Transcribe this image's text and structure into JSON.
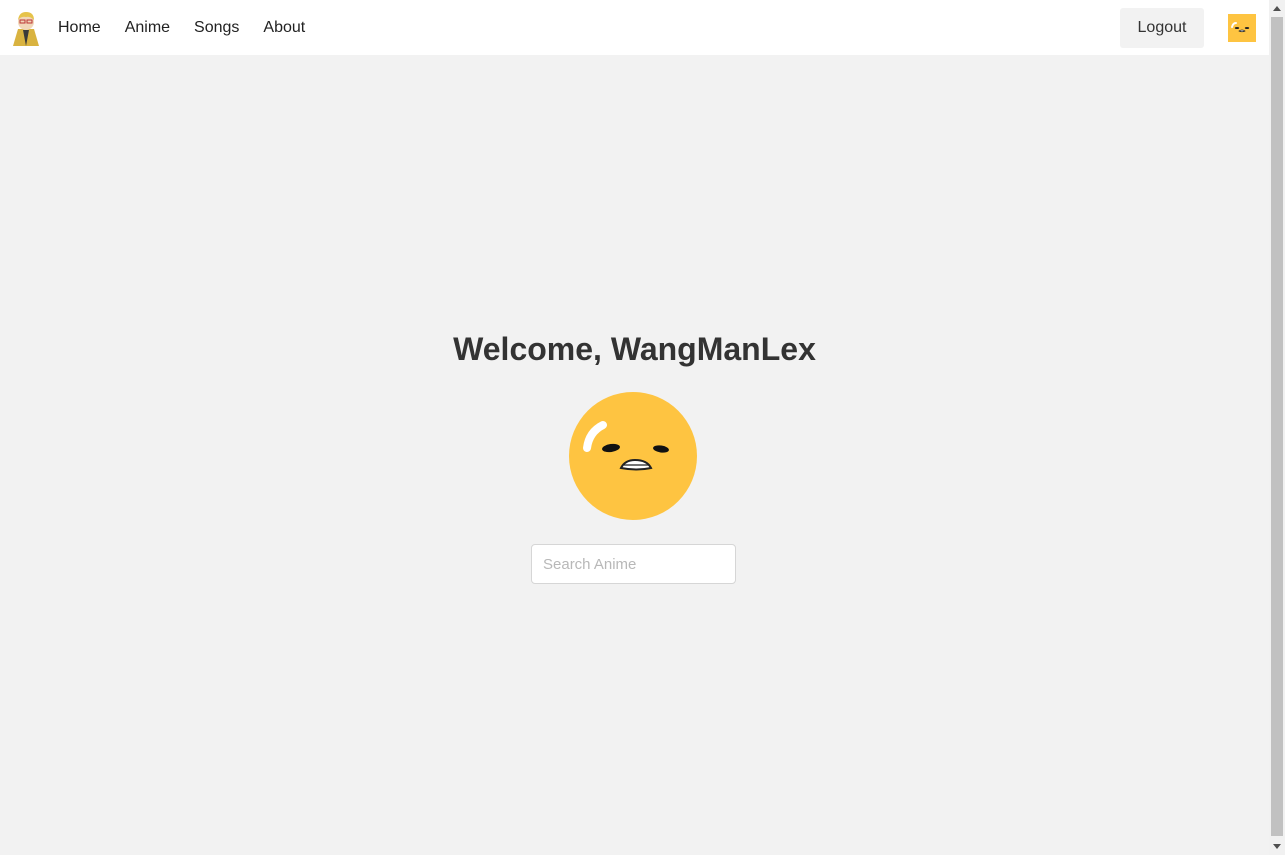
{
  "navbar": {
    "links": [
      {
        "label": "Home"
      },
      {
        "label": "Anime"
      },
      {
        "label": "Songs"
      },
      {
        "label": "About"
      }
    ],
    "logout_label": "Logout"
  },
  "main": {
    "welcome_text": "Welcome, WangManLex",
    "search": {
      "placeholder": "Search Anime",
      "value": ""
    }
  },
  "colors": {
    "accent_yellow": "#fec441",
    "background": "#f2f2f2",
    "navbar": "#ffffff"
  }
}
